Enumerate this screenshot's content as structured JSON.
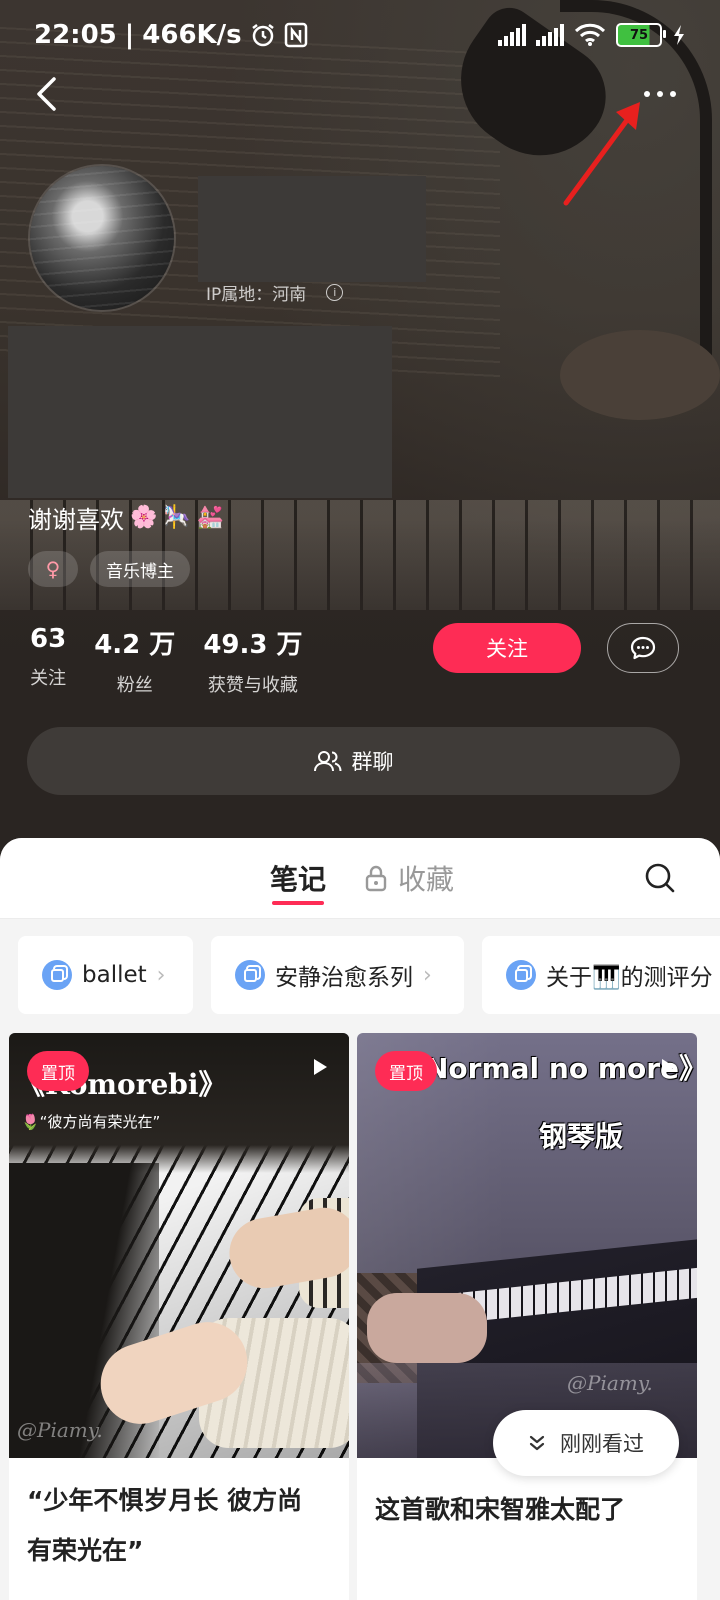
{
  "status_bar": {
    "time": "22:05",
    "net_speed": "466K/s",
    "battery": "75"
  },
  "profile": {
    "ip_location": "IP属地：河南",
    "bio": "谢谢喜欢",
    "bio_emojis": [
      "🌸",
      "🎠",
      "💒"
    ],
    "gender_symbol": "♀",
    "tag": "音乐博主",
    "stats": [
      {
        "value": "63",
        "label": "关注"
      },
      {
        "value": "4.2 万",
        "label": "粉丝"
      },
      {
        "value": "49.3 万",
        "label": "获赞与收藏"
      }
    ],
    "follow_label": "关注",
    "group_chat_label": "群聊"
  },
  "tabs": {
    "notes": "笔记",
    "favorites": "收藏"
  },
  "collections": [
    {
      "label": "ballet"
    },
    {
      "label": "安静治愈系列"
    },
    {
      "label": "关于🎹的测评分"
    }
  ],
  "cards": [
    {
      "pin_label": "置顶",
      "overlay_title": "《Komorebi》",
      "overlay_subtitle": "🌷“彼方尚有荣光在”",
      "watermark": "@Piamy.",
      "title": "“少年不惧岁月长 彼方尚有荣光在”"
    },
    {
      "pin_label": "置顶",
      "overlay_title": "《Normal no more》",
      "overlay_subtitle": "钢琴版",
      "watermark": "@Piamy.",
      "title": "这首歌和宋智雅太配了"
    }
  ],
  "recently_viewed_label": "刚刚看过",
  "colors": {
    "accent": "#fe2c55",
    "collection_icon": "#6aa3f5",
    "annotation_arrow": "#e8201e"
  }
}
